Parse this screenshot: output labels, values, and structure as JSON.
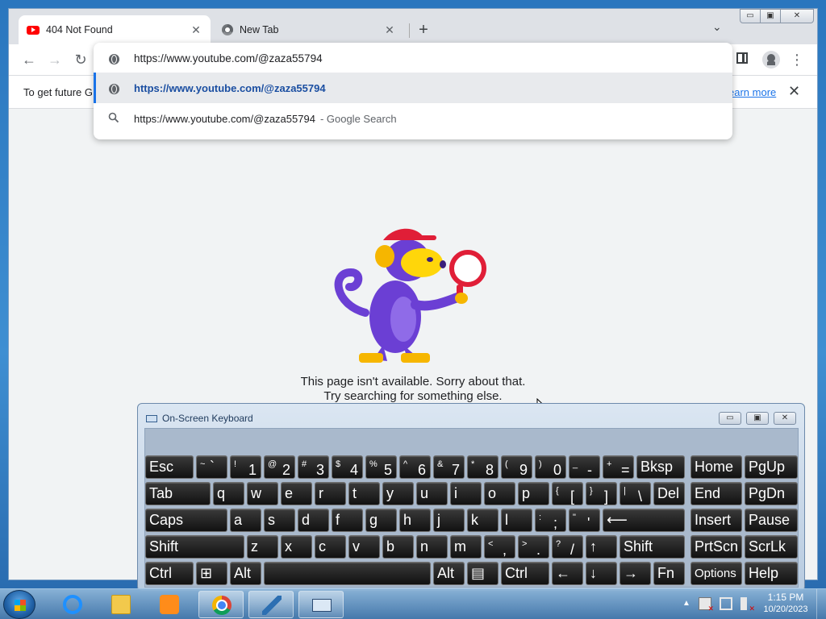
{
  "browser": {
    "tabs": [
      {
        "label": "404 Not Found",
        "favicon": "youtube-icon"
      },
      {
        "label": "New Tab",
        "favicon": "chrome-icon"
      }
    ],
    "new_tab_symbol": "+",
    "tab_close_symbol": "✕",
    "window_controls": {
      "minimize": "▭",
      "maximize": "▣",
      "close": "✕"
    }
  },
  "toolbar": {
    "back": "←",
    "forward": "→",
    "reload": "↻",
    "menu": "⋮"
  },
  "omnibox": {
    "input_value": "https://www.youtube.com/@zaza55794",
    "suggestions": [
      {
        "text": "https://www.youtube.com/@zaza55794",
        "icon": "globe-icon"
      },
      {
        "text": "https://www.youtube.com/@zaza55794",
        "suffix": "- Google Search",
        "icon": "search-icon"
      }
    ]
  },
  "infobar": {
    "text": "To get future G",
    "link": "earn more",
    "close": "✕"
  },
  "page": {
    "error_line1": "This page isn't available. Sorry about that.",
    "error_line2": "Try searching for something else."
  },
  "osk": {
    "title": "On-Screen Keyboard",
    "controls": {
      "minimize": "▭",
      "maximize": "▣",
      "close": "✕"
    },
    "keys": {
      "esc": "Esc",
      "tilde_sh": "~",
      "tilde": "`",
      "k1_sh": "!",
      "k1": "1",
      "k2_sh": "@",
      "k2": "2",
      "k3_sh": "#",
      "k3": "3",
      "k4_sh": "$",
      "k4": "4",
      "k5_sh": "%",
      "k5": "5",
      "k6_sh": "^",
      "k6": "6",
      "k7_sh": "&",
      "k7": "7",
      "k8_sh": "*",
      "k8": "8",
      "k9_sh": "(",
      "k9": "9",
      "k0_sh": ")",
      "k0": "0",
      "minus_sh": "_",
      "minus": "-",
      "equal_sh": "+",
      "equal": "=",
      "bksp": "Bksp",
      "home": "Home",
      "pgup": "PgUp",
      "tab": "Tab",
      "q": "q",
      "w": "w",
      "e": "e",
      "r": "r",
      "t": "t",
      "y": "y",
      "u": "u",
      "i": "i",
      "o": "o",
      "p": "p",
      "lbr_sh": "{",
      "lbr": "[",
      "rbr_sh": "}",
      "rbr": "]",
      "bsl_sh": "|",
      "bsl": "\\",
      "del": "Del",
      "end": "End",
      "pgdn": "PgDn",
      "caps": "Caps",
      "a": "a",
      "s": "s",
      "d": "d",
      "f": "f",
      "g": "g",
      "h": "h",
      "j": "j",
      "k": "k",
      "l": "l",
      "semi_sh": ":",
      "semi": ";",
      "quote_sh": "\"",
      "quote": "'",
      "enter": "⟵",
      "insert": "Insert",
      "pause": "Pause",
      "shift": "Shift",
      "z": "z",
      "x": "x",
      "c": "c",
      "v": "v",
      "b": "b",
      "n": "n",
      "m": "m",
      "comma_sh": "<",
      "comma": ",",
      "period_sh": ">",
      "period": ".",
      "slash_sh": "?",
      "slash": "/",
      "up": "↑",
      "prtscn": "PrtScn",
      "scrlk": "ScrLk",
      "ctrl": "Ctrl",
      "win": "⊞",
      "alt": "Alt",
      "menu": "▤",
      "left": "←",
      "down": "↓",
      "right": "→",
      "fn": "Fn",
      "options": "Options",
      "help": "Help"
    }
  },
  "taskbar": {
    "clock_time": "1:15 PM",
    "clock_date": "10/20/2023",
    "tray_arrow": "▲",
    "items": [
      "ie-icon",
      "explorer-icon",
      "media-icon",
      "chrome-icon",
      "app-icon",
      "keyboard-icon"
    ]
  }
}
